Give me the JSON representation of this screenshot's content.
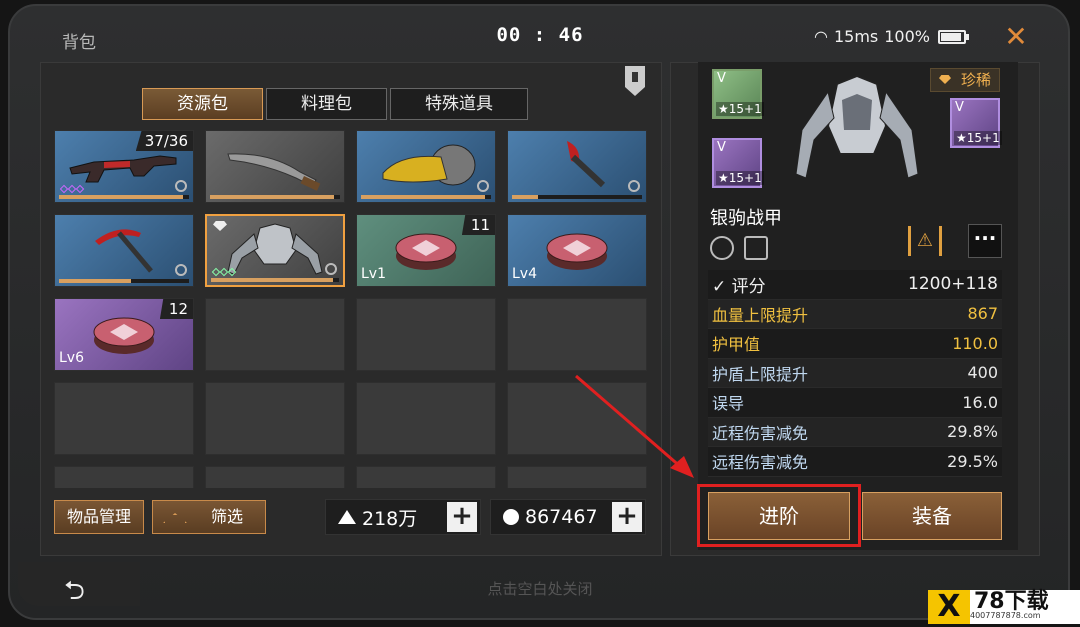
{
  "header": {
    "title": "背包",
    "clock": "00 : 46",
    "ping": "15ms",
    "battery": "100%"
  },
  "tabs": [
    {
      "label": "资源包",
      "active": true
    },
    {
      "label": "料理包",
      "active": false
    },
    {
      "label": "特殊道具",
      "active": false
    }
  ],
  "inventory": [
    {
      "name": "rifle",
      "count": "37/36",
      "rarity": "blue",
      "progress": 0.95
    },
    {
      "name": "machete",
      "rarity": "gray",
      "progress": 0.95
    },
    {
      "name": "vehicle-part",
      "rarity": "blue",
      "progress": 0.95
    },
    {
      "name": "axe",
      "rarity": "blue",
      "progress": 0.2
    },
    {
      "name": "pickaxe",
      "rarity": "blue",
      "progress": 0.55
    },
    {
      "name": "armor",
      "rarity": "gray",
      "selected": true,
      "progress": 0.95
    },
    {
      "name": "chest",
      "count": "11",
      "level": "Lv1",
      "rarity": "green"
    },
    {
      "name": "chest",
      "level": "Lv4",
      "rarity": "blue"
    },
    {
      "name": "chest",
      "count": "12",
      "level": "Lv6",
      "rarity": "purple"
    }
  ],
  "bottom": {
    "manage_label": "物品管理",
    "filter_label": "筛选",
    "resource_amount": "218万",
    "coin_amount": "867467",
    "close_hint": "点击空白处关闭"
  },
  "detail": {
    "rarity": "珍稀",
    "item_name": "银驹战甲",
    "modules": [
      {
        "tier": "V",
        "stars": "15+1",
        "color": "green"
      },
      {
        "tier": "V",
        "stars": "15+1",
        "color": "purple"
      },
      {
        "tier": "V",
        "stars": "15+1",
        "color": "purple"
      }
    ],
    "stats": [
      {
        "key": "评分",
        "value": "1200+118",
        "style": "score"
      },
      {
        "key": "血量上限提升",
        "value": "867",
        "style": "gold"
      },
      {
        "key": "护甲值",
        "value": "110.0",
        "style": "gold"
      },
      {
        "key": "护盾上限提升",
        "value": "400",
        "style": "normal"
      },
      {
        "key": "误导",
        "value": "16.0",
        "style": "normal"
      },
      {
        "key": "近程伤害减免",
        "value": "29.8%",
        "style": "normal"
      },
      {
        "key": "远程伤害减免",
        "value": "29.5%",
        "style": "normal"
      }
    ],
    "advance_label": "进阶",
    "equip_label": "装备"
  },
  "watermark": {
    "brand": "78下载",
    "url": "4007787878.com"
  }
}
